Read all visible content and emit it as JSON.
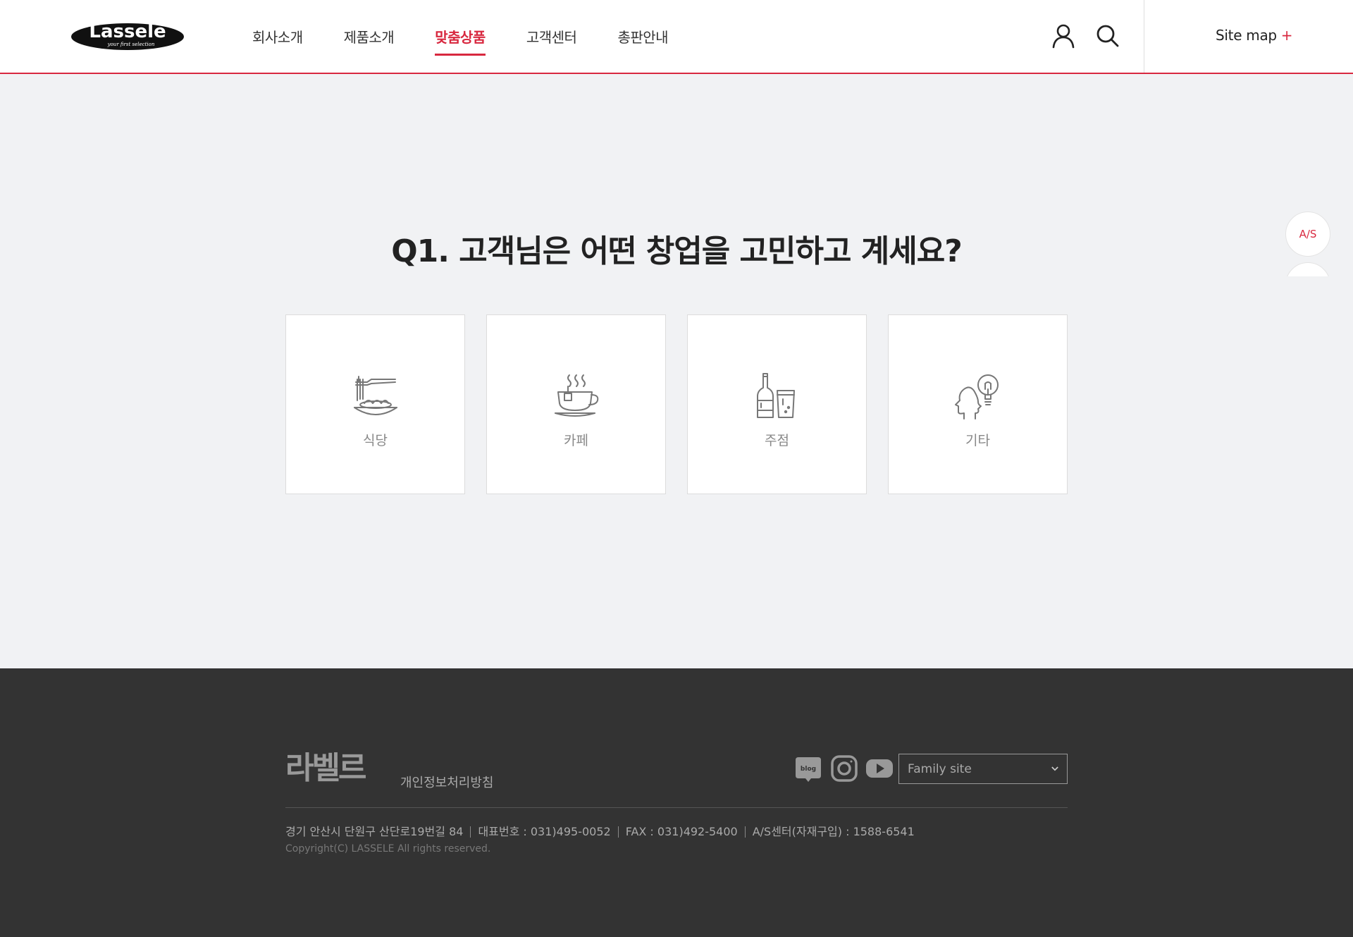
{
  "header": {
    "logo_text": "Lassele",
    "logo_tagline": "your first selection",
    "nav": [
      {
        "label": "회사소개"
      },
      {
        "label": "제품소개"
      },
      {
        "label": "맞춤상품",
        "active": true
      },
      {
        "label": "고객센터"
      },
      {
        "label": "총판안내"
      }
    ],
    "sitemap_label": "Site map",
    "sitemap_plus": "+"
  },
  "main": {
    "question": "Q1. 고객님은 어떤 창업을 고민하고 계세요?",
    "options": [
      {
        "label": "식당",
        "icon": "noodle-icon"
      },
      {
        "label": "카페",
        "icon": "coffee-icon"
      },
      {
        "label": "주점",
        "icon": "bottle-icon"
      },
      {
        "label": "기타",
        "icon": "idea-icon"
      }
    ]
  },
  "side": {
    "as_label": "A/S"
  },
  "footer": {
    "logo_text": "라벨르",
    "privacy_label": "개인정보처리방침",
    "family_site": "Family site",
    "blog_label": "blog",
    "info": [
      "경기 안산시 단원구 산단로19번길 84",
      "대표번호 : 031)495-0052",
      "FAX : 031)492-5400",
      "A/S센터(자재구입) : 1588-6541"
    ],
    "copyright": "Copyright(C) LASSELE All rights reserved."
  },
  "colors": {
    "accent": "#d8283f",
    "background": "#f1f2f4",
    "footer": "#333333"
  }
}
